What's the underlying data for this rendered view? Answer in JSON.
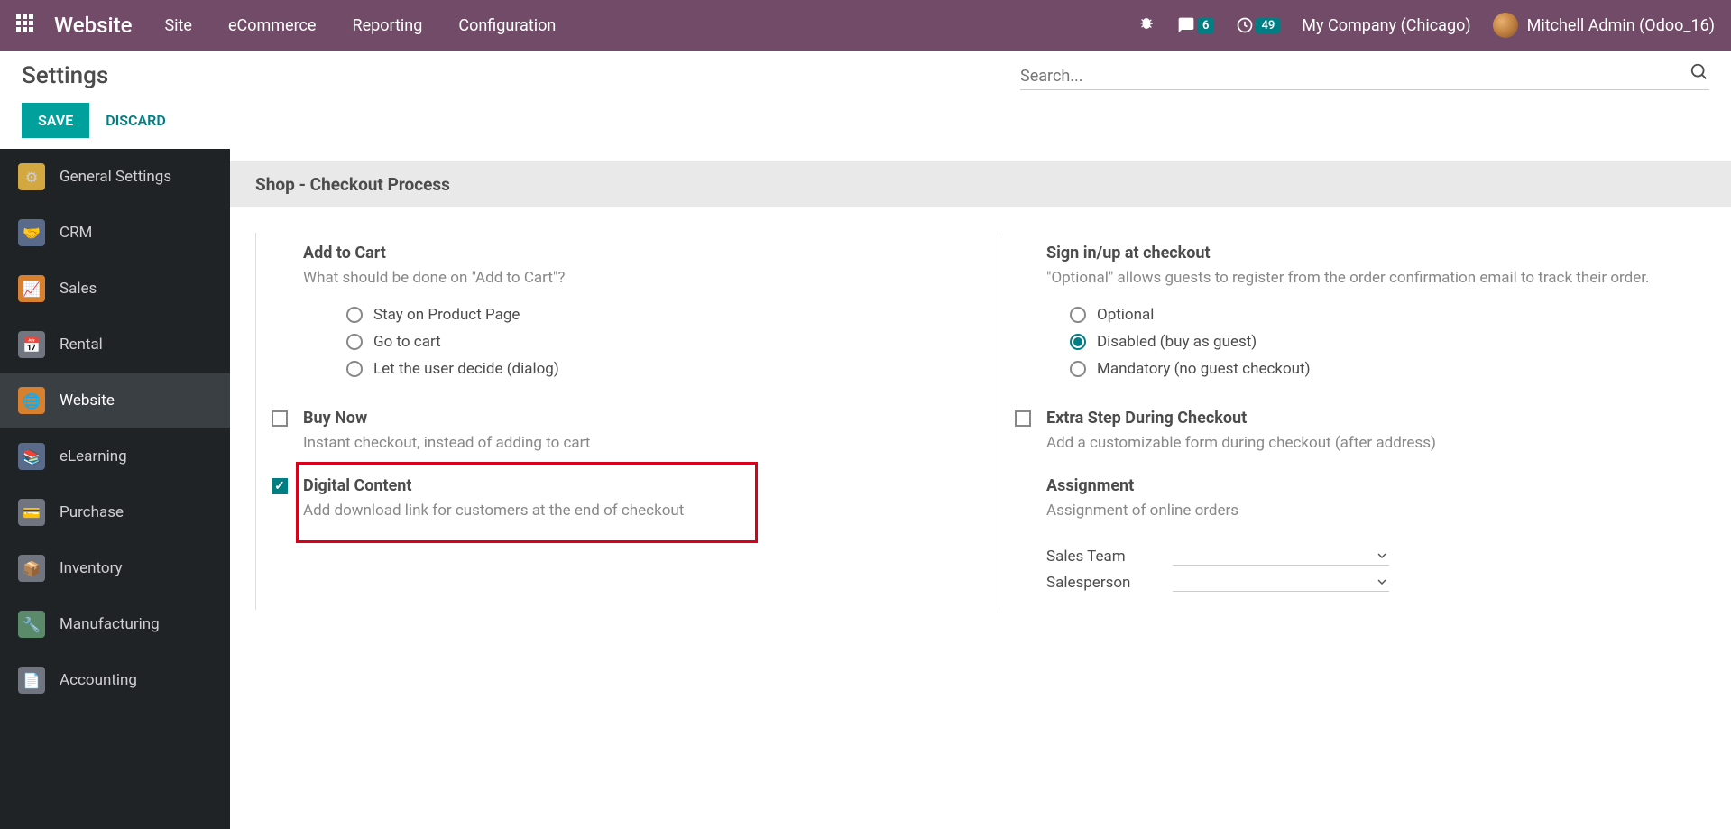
{
  "topnav": {
    "brand": "Website",
    "links": [
      "Site",
      "eCommerce",
      "Reporting",
      "Configuration"
    ],
    "messages_badge": "6",
    "activities_badge": "49",
    "company": "My Company (Chicago)",
    "user": "Mitchell Admin (Odoo_16)"
  },
  "page": {
    "title": "Settings",
    "search_placeholder": "Search..."
  },
  "actions": {
    "save": "SAVE",
    "discard": "DISCARD"
  },
  "sidebar": {
    "items": [
      {
        "label": "General Settings",
        "icon": "general"
      },
      {
        "label": "CRM",
        "icon": "crm"
      },
      {
        "label": "Sales",
        "icon": "sales"
      },
      {
        "label": "Rental",
        "icon": "rental"
      },
      {
        "label": "Website",
        "icon": "website",
        "active": true
      },
      {
        "label": "eLearning",
        "icon": "elearning"
      },
      {
        "label": "Purchase",
        "icon": "purchase"
      },
      {
        "label": "Inventory",
        "icon": "inventory"
      },
      {
        "label": "Manufacturing",
        "icon": "manufacturing"
      },
      {
        "label": "Accounting",
        "icon": "accounting"
      }
    ]
  },
  "section": {
    "title": "Shop - Checkout Process"
  },
  "settings": {
    "add_to_cart": {
      "title": "Add to Cart",
      "desc": "What should be done on \"Add to Cart\"?",
      "options": [
        "Stay on Product Page",
        "Go to cart",
        "Let the user decide (dialog)"
      ],
      "selected": null
    },
    "signin": {
      "title": "Sign in/up at checkout",
      "desc": "\"Optional\" allows guests to register from the order confirmation email to track their order.",
      "options": [
        "Optional",
        "Disabled (buy as guest)",
        "Mandatory (no guest checkout)"
      ],
      "selected": 1
    },
    "buy_now": {
      "title": "Buy Now",
      "desc": "Instant checkout, instead of adding to cart",
      "checked": false
    },
    "extra_step": {
      "title": "Extra Step During Checkout",
      "desc": "Add a customizable form during checkout (after address)",
      "checked": false
    },
    "digital": {
      "title": "Digital Content",
      "desc": "Add download link for customers at the end of checkout",
      "checked": true
    },
    "assignment": {
      "title": "Assignment",
      "desc": "Assignment of online orders",
      "fields": [
        {
          "label": "Sales Team"
        },
        {
          "label": "Salesperson"
        }
      ]
    }
  }
}
